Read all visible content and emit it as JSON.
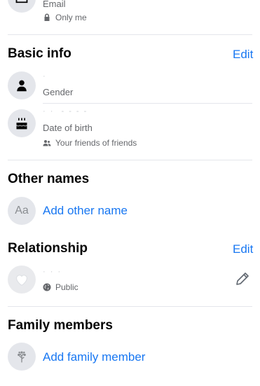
{
  "contact": {
    "label": "Email",
    "privacy": "Only me"
  },
  "basic_info": {
    "heading": "Basic info",
    "edit_label": "Edit",
    "gender": {
      "label": "Gender"
    },
    "birth": {
      "label": "Date of birth",
      "privacy": "Your friends of friends"
    }
  },
  "other_names": {
    "heading": "Other names",
    "icon_text": "Aa",
    "add_label": "Add other name"
  },
  "relationship": {
    "heading": "Relationship",
    "edit_label": "Edit",
    "privacy": "Public"
  },
  "family": {
    "heading": "Family members",
    "add_label": "Add family member"
  },
  "colors": {
    "accent": "#1877f2",
    "icon_bg": "#e4e6eb",
    "secondary_text": "#65676b"
  }
}
